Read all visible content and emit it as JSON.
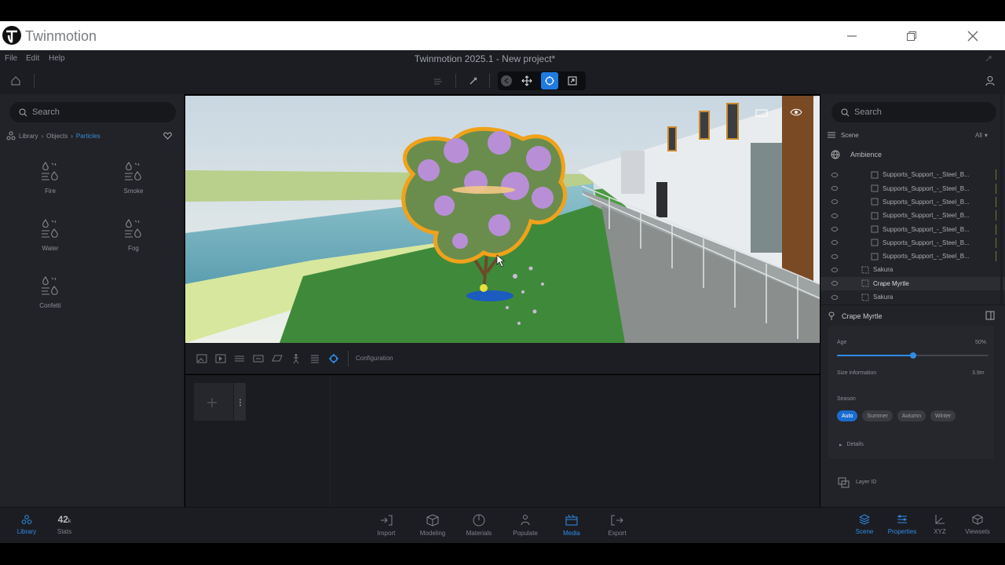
{
  "window": {
    "brand": "Twinmotion"
  },
  "menu": {
    "items": [
      "File",
      "Edit",
      "Help"
    ],
    "app_title": "Twinmotion 2025.1 - New project*"
  },
  "left": {
    "search_placeholder": "Search",
    "breadcrumb": [
      "Library",
      "Objects",
      "Particles"
    ],
    "items": [
      "Fire",
      "Smoke",
      "Water",
      "Fog",
      "Confetti"
    ]
  },
  "viewport_toolbar": {
    "configuration_label": "Configuration"
  },
  "right": {
    "search_placeholder": "Search",
    "scene_label": "Scene",
    "filter_label": "All",
    "ambience_label": "Ambience",
    "tree_items": [
      "Supports_Support_-_Steel_B...",
      "Supports_Support_-_Steel_B...",
      "Supports_Support_-_Steel_B...",
      "Supports_Support_-_Steel_B...",
      "Supports_Support_-_Steel_B...",
      "Supports_Support_-_Steel_B...",
      "Supports_Support_-_Steel_B...",
      "Sakura",
      "Crape Myrtle",
      "Sakura"
    ],
    "props": {
      "title": "Crape Myrtle",
      "age_label": "Age",
      "age_value": "50%",
      "age_fraction": 0.5,
      "size_label": "Size information",
      "size_value": "3.9m",
      "season_label": "Season",
      "seasons": [
        "Auto",
        "Summer",
        "Autumn",
        "Winter"
      ],
      "details_label": "Details",
      "layer_label": "Layer ID"
    }
  },
  "bottom": {
    "left": [
      {
        "label": "Library"
      },
      {
        "count": "42",
        "unit": "k",
        "label": "Stats"
      }
    ],
    "center": [
      "Import",
      "Modeling",
      "Materials",
      "Populate",
      "Media",
      "Export"
    ],
    "right": [
      "Scene",
      "Properties",
      "XYZ",
      "Viewsets"
    ]
  },
  "colors": {
    "accent": "#2f8ce8",
    "selection_outline": "#f0a21a"
  }
}
